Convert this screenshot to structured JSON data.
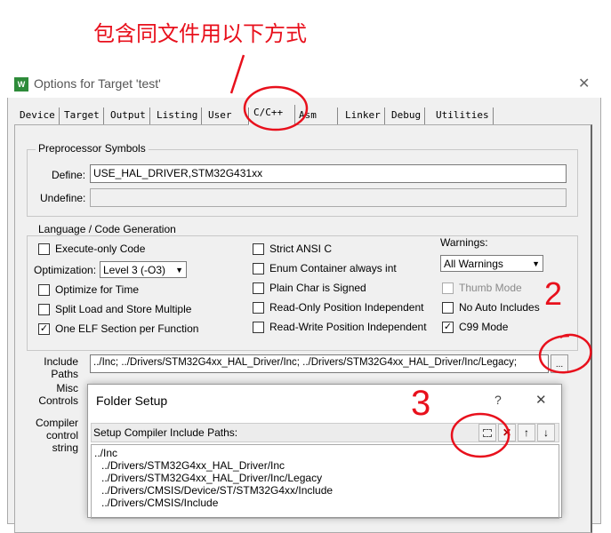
{
  "annotation": {
    "title": "包含同文件用以下方式",
    "mark2": "2",
    "mark3": "3"
  },
  "dialog": {
    "title": "Options for Target 'test'",
    "close": "✕"
  },
  "tabs": [
    "Device",
    "Target",
    "Output",
    "Listing",
    "User",
    "C/C++",
    "Asm",
    "Linker",
    "Debug",
    "Utilities"
  ],
  "preprocessor": {
    "group": "Preprocessor Symbols",
    "define_label": "Define:",
    "define_value": "USE_HAL_DRIVER,STM32G431xx",
    "undefine_label": "Undefine:",
    "undefine_value": ""
  },
  "lang": {
    "group": "Language / Code Generation",
    "execute_only": "Execute-only Code",
    "optimization_label": "Optimization:",
    "optimization_value": "Level 3 (-O3)",
    "optimize_time": "Optimize for Time",
    "split_load": "Split Load and Store Multiple",
    "one_elf": "One ELF Section per Function",
    "strict_ansi": "Strict ANSI C",
    "enum_container": "Enum Container always int",
    "plain_char": "Plain Char is Signed",
    "ro_pos": "Read-Only Position Independent",
    "rw_pos": "Read-Write Position Independent",
    "warnings_label": "Warnings:",
    "warnings_value": "All Warnings",
    "thumb_mode": "Thumb Mode",
    "no_auto": "No Auto Includes",
    "c99": "C99 Mode"
  },
  "include": {
    "label1": "Include",
    "label2": "Paths",
    "value": "../Inc;   ../Drivers/STM32G4xx_HAL_Driver/Inc;   ../Drivers/STM32G4xx_HAL_Driver/Inc/Legacy;",
    "browse": "..."
  },
  "misc": {
    "label1": "Misc",
    "label2": "Controls"
  },
  "compiler": {
    "label1": "Compiler",
    "label2": "control",
    "label3": "string"
  },
  "folder_setup": {
    "title": "Folder Setup",
    "help": "?",
    "close": "✕",
    "header": "Setup Compiler Include Paths:",
    "paths": [
      "../Inc",
      "../Drivers/STM32G4xx_HAL_Driver/Inc",
      "../Drivers/STM32G4xx_HAL_Driver/Inc/Legacy",
      "../Drivers/CMSIS/Device/ST/STM32G4xx/Include",
      "../Drivers/CMSIS/Include"
    ]
  },
  "colors": {
    "annotation": "#e8101c"
  }
}
